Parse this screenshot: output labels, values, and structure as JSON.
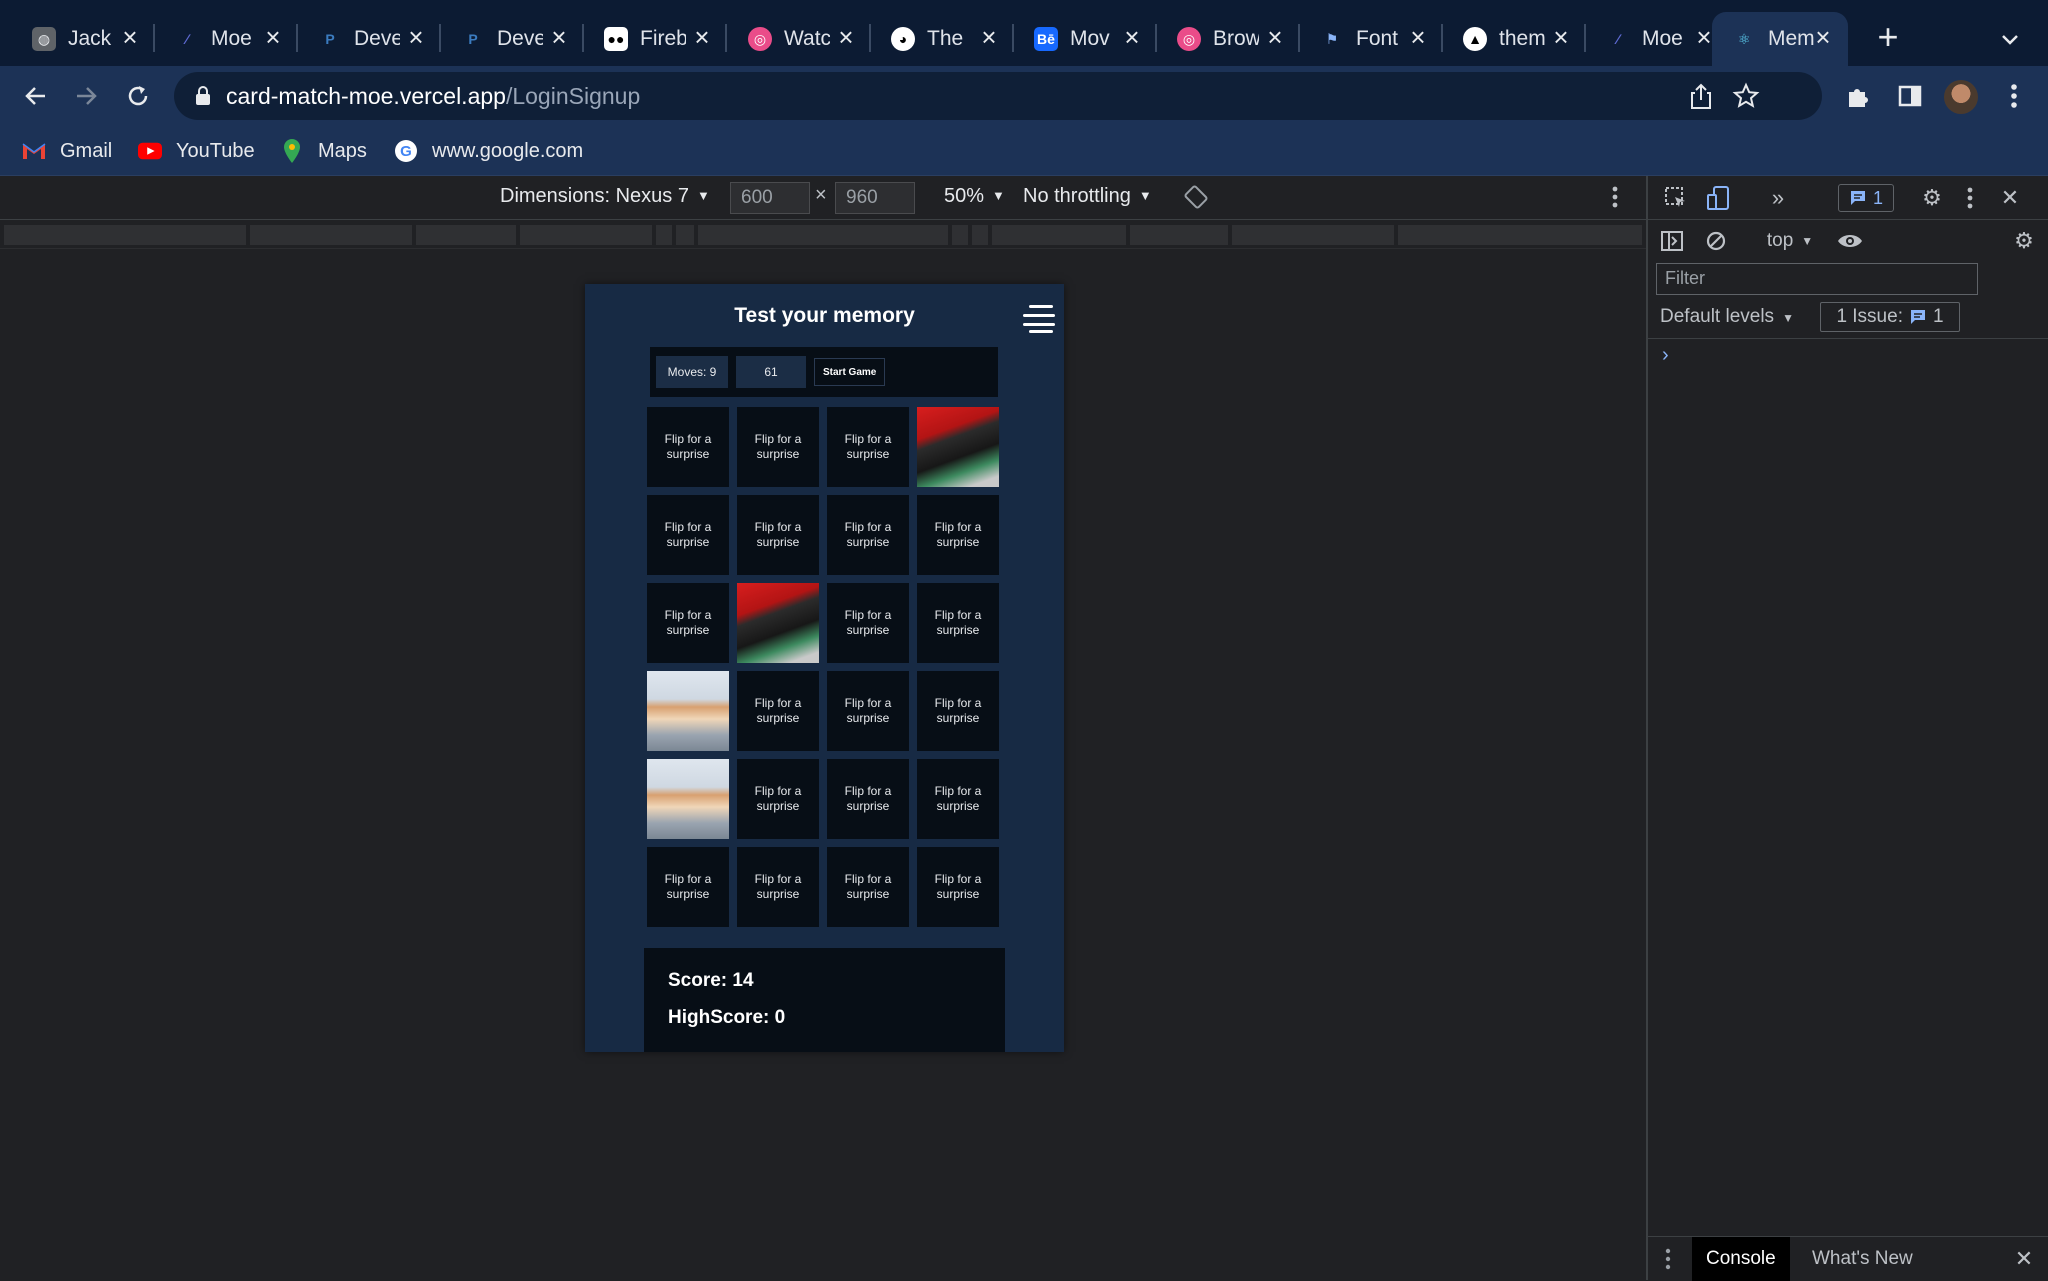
{
  "tabs": [
    {
      "title": "Jack",
      "icon": "globe-icon"
    },
    {
      "title": "Moe",
      "icon": "linear-icon"
    },
    {
      "title": "Deve",
      "icon": "paypal-icon"
    },
    {
      "title": "Deve",
      "icon": "paypal-icon"
    },
    {
      "title": "Fireb",
      "icon": "medium-icon"
    },
    {
      "title": "Watc",
      "icon": "dribbble-icon"
    },
    {
      "title": "The",
      "icon": "github-icon"
    },
    {
      "title": "Mov",
      "icon": "behance-icon"
    },
    {
      "title": "Brow",
      "icon": "dribbble-icon"
    },
    {
      "title": "Font",
      "icon": "flag-icon"
    },
    {
      "title": "them",
      "icon": "triangle-icon"
    },
    {
      "title": "Moe",
      "icon": "linear-icon"
    },
    {
      "title": "Mem",
      "icon": "react-icon"
    }
  ],
  "omnibox": {
    "host": "card-match-moe.vercel.app",
    "path": "/LoginSignup"
  },
  "bookmarks": [
    "Gmail",
    "YouTube",
    "Maps",
    "www.google.com"
  ],
  "device_toolbar": {
    "dimensions_label": "Dimensions: Nexus 7",
    "width": "600",
    "height": "960",
    "times": "×",
    "zoom": "50%",
    "throttling": "No throttling"
  },
  "game": {
    "title": "Test your memory",
    "moves_label": "Moves: 9",
    "timer": "61",
    "start_label": "Start Game",
    "card_back_text": "Flip for a surprise",
    "cards": [
      "back",
      "back",
      "back",
      "cat",
      "back",
      "back",
      "back",
      "back",
      "back",
      "cat",
      "back",
      "back",
      "dog",
      "back",
      "back",
      "back",
      "dog",
      "back",
      "back",
      "back",
      "back",
      "back",
      "back",
      "back"
    ],
    "score_label": "Score: 14",
    "highscore_label": "HighScore: 0"
  },
  "devtools": {
    "messages_count": "1",
    "context": "top",
    "filter_placeholder": "Filter",
    "levels": "Default levels",
    "issues_label": "1 Issue:",
    "issues_count": "1",
    "prompt": "›",
    "drawer_tabs": [
      "Console",
      "What's New"
    ]
  },
  "colors": {
    "tab_strip": "#0c1b33",
    "toolbar": "#1c3256",
    "app_bg": "#172a44",
    "card_bg": "#070e16",
    "link_blue": "#8ab4f8"
  }
}
